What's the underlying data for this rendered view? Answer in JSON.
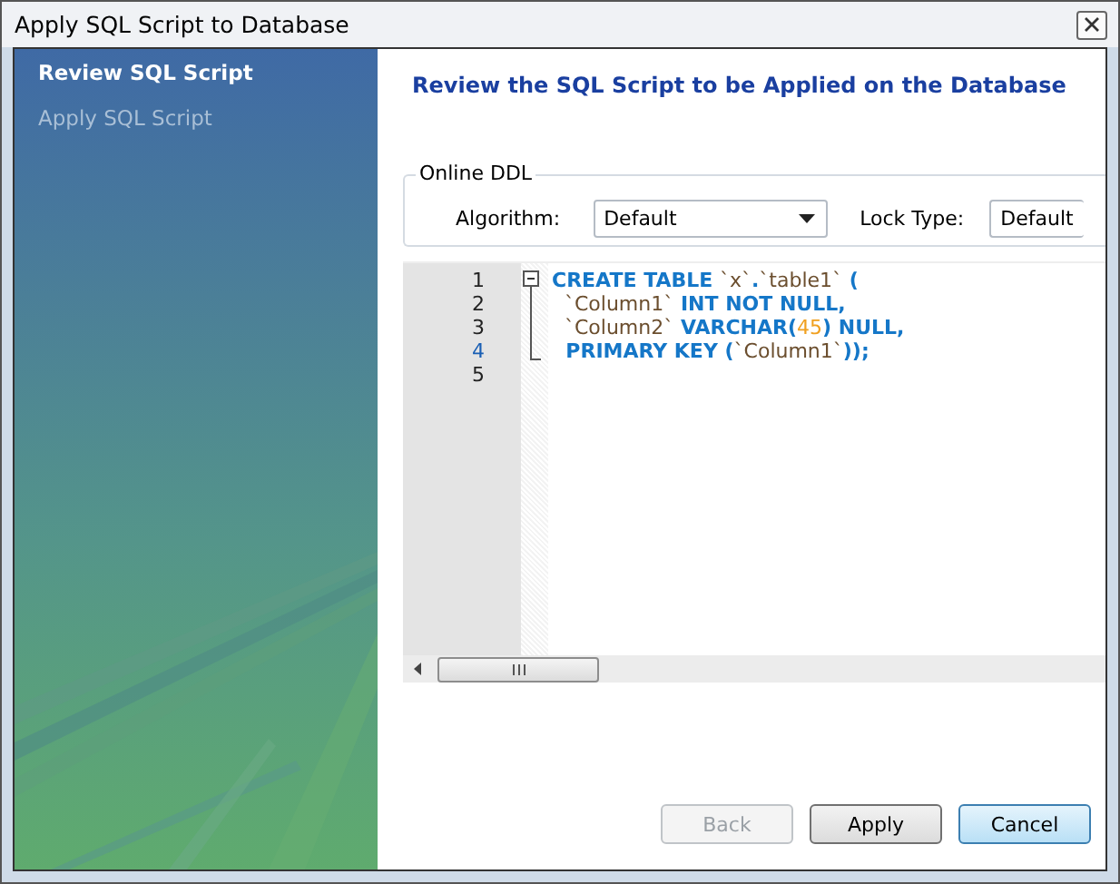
{
  "window": {
    "title": "Apply SQL Script to Database"
  },
  "sidebar": {
    "items": [
      {
        "label": "Review SQL Script",
        "selected": true
      },
      {
        "label": "Apply SQL Script",
        "selected": false
      }
    ]
  },
  "heading": "Review the SQL Script to be Applied on the Database",
  "online_ddl": {
    "title": "Online DDL",
    "algorithm": {
      "label": "Algorithm:",
      "value": "Default"
    },
    "lock_type": {
      "label": "Lock Type:",
      "value": "Default"
    }
  },
  "editor": {
    "lines": [
      {
        "number": "1",
        "current": false,
        "tokens": [
          {
            "kind": "keyword",
            "text": "CREATE TABLE "
          },
          {
            "kind": "ident",
            "text": "`x`"
          },
          {
            "kind": "keyword",
            "text": "."
          },
          {
            "kind": "ident",
            "text": "`table1`"
          },
          {
            "kind": "keyword",
            "text": " ("
          }
        ]
      },
      {
        "number": "2",
        "current": false,
        "tokens": [
          {
            "kind": "ident",
            "text": "  `Column1`"
          },
          {
            "kind": "keyword",
            "text": " INT NOT NULL,"
          }
        ]
      },
      {
        "number": "3",
        "current": false,
        "tokens": [
          {
            "kind": "ident",
            "text": "  `Column2`"
          },
          {
            "kind": "keyword",
            "text": " VARCHAR("
          },
          {
            "kind": "number",
            "text": "45"
          },
          {
            "kind": "keyword",
            "text": ") NULL,"
          }
        ]
      },
      {
        "number": "4",
        "current": true,
        "tokens": [
          {
            "kind": "keyword",
            "text": "  PRIMARY KEY ("
          },
          {
            "kind": "ident",
            "text": "`Column1`"
          },
          {
            "kind": "keyword",
            "text": "));"
          }
        ]
      },
      {
        "number": "5",
        "current": false
      }
    ]
  },
  "buttons": [
    {
      "label": "Back",
      "disabled": true,
      "default": false
    },
    {
      "label": "Apply",
      "disabled": false,
      "default": false
    },
    {
      "label": "Cancel",
      "disabled": false,
      "default": true
    }
  ]
}
